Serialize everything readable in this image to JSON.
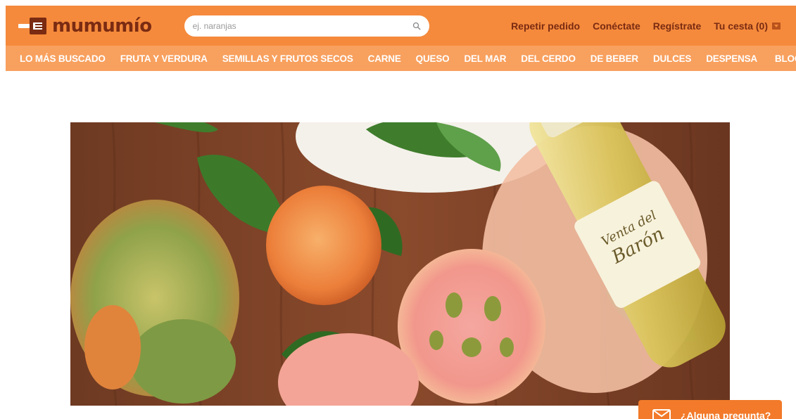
{
  "header": {
    "logo_text": "mumumío",
    "search_placeholder": "ej. naranjas",
    "links": {
      "repeat_order": "Repetir pedido",
      "login": "Conéctate",
      "register": "Regístrate",
      "cart": "Tu cesta (0)"
    }
  },
  "nav": {
    "items": [
      "LO MÁS BUSCADO",
      "FRUTA Y VERDURA",
      "SEMILLAS Y FRUTOS SECOS",
      "CARNE",
      "QUESO",
      "DEL MAR",
      "DEL CERDO",
      "DE BEBER",
      "DULCES",
      "DESPENSA"
    ],
    "blog": "BLOG"
  },
  "hero": {
    "bottle_label_line1": "Venta del",
    "bottle_label_line2": "Barón"
  },
  "help_widget": {
    "label": "¿Alguna pregunta?"
  },
  "colors": {
    "topbar": "#f58a3c",
    "catnav": "#f8a05e",
    "brand_dark": "#7a2b12",
    "help_button": "#f27a2a"
  },
  "icons": {
    "logo": "fork-box-icon",
    "search": "search-icon",
    "cart_caret": "caret-down-icon",
    "help": "mail-icon"
  }
}
